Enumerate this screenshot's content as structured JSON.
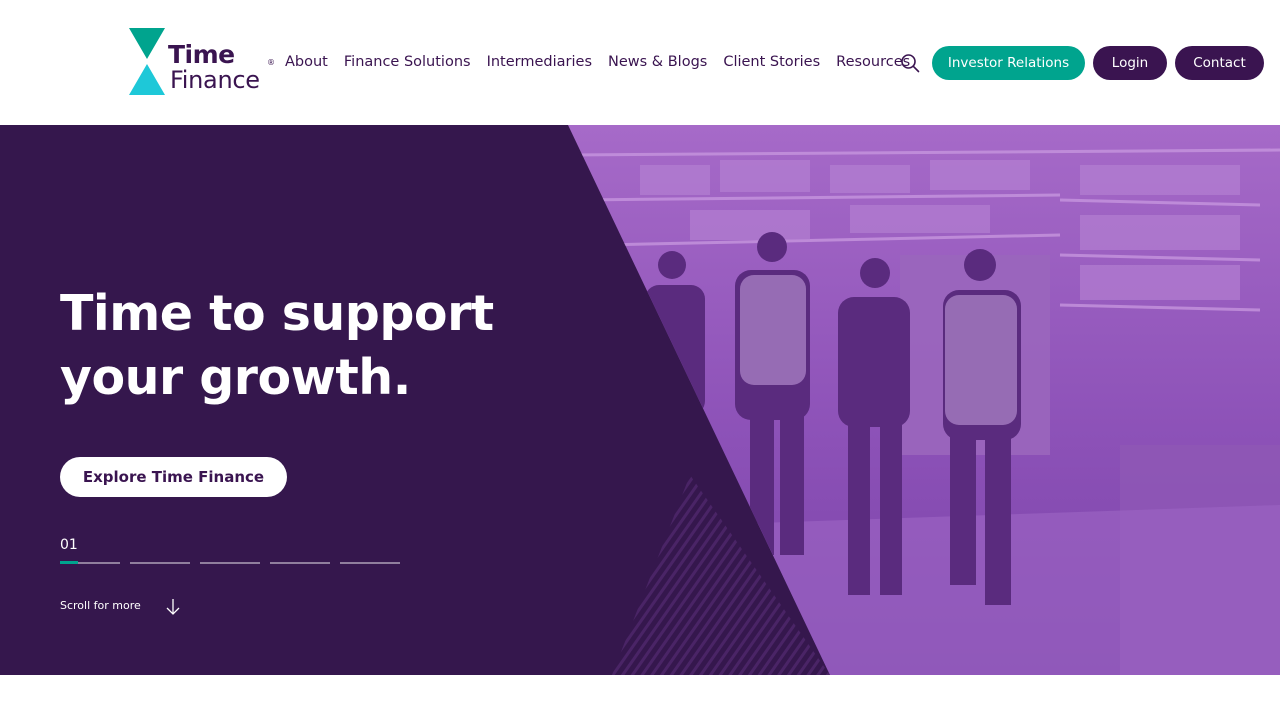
{
  "brand": {
    "word1": "Time",
    "word2": "Finance",
    "reg": "®",
    "colors": {
      "purple": "#3a1450",
      "teal": "#00a48e",
      "cyan": "#1ec8d8",
      "hero_bg": "#35174d"
    }
  },
  "nav": {
    "items": [
      {
        "label": "About"
      },
      {
        "label": "Finance Solutions"
      },
      {
        "label": "Intermediaries"
      },
      {
        "label": "News & Blogs"
      },
      {
        "label": "Client Stories"
      },
      {
        "label": "Resources"
      }
    ],
    "search_icon": "search-icon"
  },
  "actions": {
    "investor": "Investor Relations",
    "login": "Login",
    "contact": "Contact"
  },
  "hero": {
    "title_line1": "Time to support",
    "title_line2": "your growth.",
    "cta": "Explore Time Finance",
    "slide_number": "01",
    "slide_count": 5,
    "scroll_label": "Scroll for more"
  }
}
